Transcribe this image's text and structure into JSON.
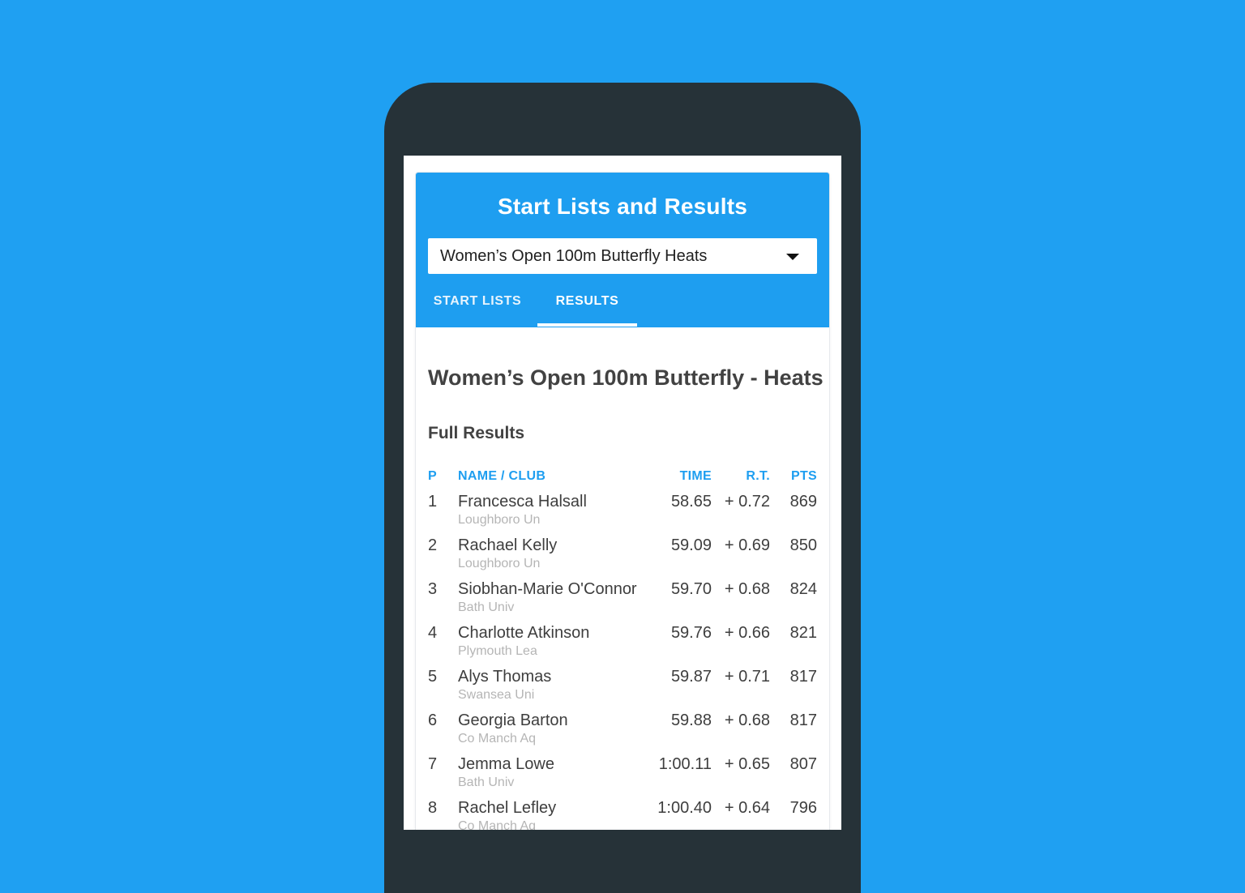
{
  "header": {
    "title": "Start Lists and Results",
    "event_select": {
      "value": "Women’s Open 100m Butterfly Heats",
      "icon": "caret-down-icon"
    },
    "tabs": [
      {
        "label": "START LISTS",
        "active": false
      },
      {
        "label": "RESULTS",
        "active": true
      }
    ]
  },
  "content": {
    "event_title": "Women’s Open 100m Butterfly - Heats",
    "section_title": "Full Results",
    "columns": {
      "pos": "P",
      "name": "NAME / CLUB",
      "time": "TIME",
      "rt": "R.T.",
      "pts": "PTS"
    },
    "results": [
      {
        "pos": "1",
        "name": "Francesca Halsall",
        "club": "Loughboro Un",
        "time": "58.65",
        "rt": "+ 0.72",
        "pts": "869"
      },
      {
        "pos": "2",
        "name": "Rachael Kelly",
        "club": "Loughboro Un",
        "time": "59.09",
        "rt": "+ 0.69",
        "pts": "850"
      },
      {
        "pos": "3",
        "name": "Siobhan-Marie O'Connor",
        "club": "Bath Univ",
        "time": "59.70",
        "rt": "+ 0.68",
        "pts": "824"
      },
      {
        "pos": "4",
        "name": "Charlotte Atkinson",
        "club": "Plymouth Lea",
        "time": "59.76",
        "rt": "+ 0.66",
        "pts": "821"
      },
      {
        "pos": "5",
        "name": "Alys Thomas",
        "club": "Swansea Uni",
        "time": "59.87",
        "rt": "+ 0.71",
        "pts": "817"
      },
      {
        "pos": "6",
        "name": "Georgia Barton",
        "club": "Co Manch Aq",
        "time": "59.88",
        "rt": "+ 0.68",
        "pts": "817"
      },
      {
        "pos": "7",
        "name": "Jemma Lowe",
        "club": "Bath Univ",
        "time": "1:00.11",
        "rt": "+ 0.65",
        "pts": "807"
      },
      {
        "pos": "8",
        "name": "Rachel Lefley",
        "club": "Co Manch Aq",
        "time": "1:00.40",
        "rt": "+ 0.64",
        "pts": "796"
      }
    ]
  },
  "colors": {
    "background": "#1fa0f2",
    "accent": "#1e9ef0",
    "device": "#263238"
  }
}
